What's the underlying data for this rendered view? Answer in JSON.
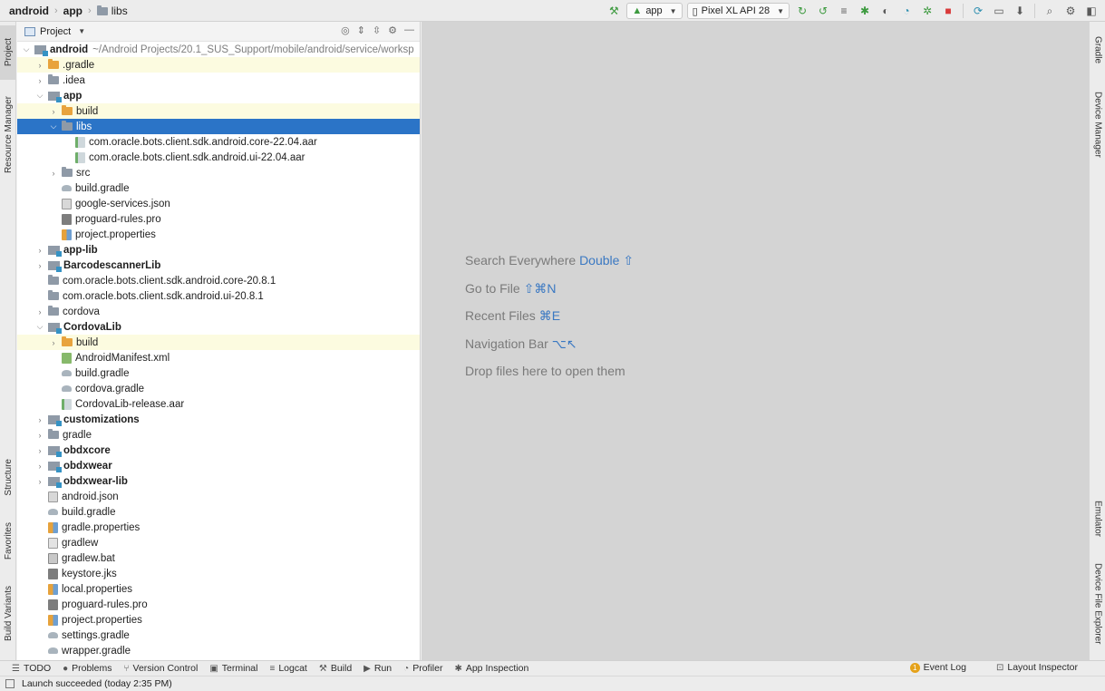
{
  "breadcrumb": [
    "android",
    "app",
    "libs"
  ],
  "toolbar": {
    "run_config": "app",
    "device": "Pixel XL API 28"
  },
  "left_tabs": [
    "Project",
    "Resource Manager",
    "Structure",
    "Favorites",
    "Build Variants"
  ],
  "right_tabs": [
    "Gradle",
    "Device Manager",
    "Emulator",
    "Device File Explorer"
  ],
  "panel": {
    "title": "Project"
  },
  "tree": [
    {
      "depth": 0,
      "exp": "open",
      "icon": "module",
      "name": "android",
      "bold": true,
      "path": "~/Android Projects/20.1_SUS_Support/mobile/android/service/worksp",
      "hl": false,
      "sel": false
    },
    {
      "depth": 1,
      "exp": "closed",
      "icon": "folder-orange",
      "name": ".gradle",
      "bold": false,
      "hl": true,
      "sel": false
    },
    {
      "depth": 1,
      "exp": "closed",
      "icon": "folder",
      "name": ".idea",
      "bold": false,
      "hl": false,
      "sel": false
    },
    {
      "depth": 1,
      "exp": "open",
      "icon": "module",
      "name": "app",
      "bold": true,
      "hl": false,
      "sel": false
    },
    {
      "depth": 2,
      "exp": "closed",
      "icon": "folder-orange",
      "name": "build",
      "bold": false,
      "hl": true,
      "sel": false
    },
    {
      "depth": 2,
      "exp": "open",
      "icon": "folder",
      "name": "libs",
      "bold": false,
      "hl": false,
      "sel": true
    },
    {
      "depth": 3,
      "exp": "none",
      "icon": "aar",
      "name": "com.oracle.bots.client.sdk.android.core-22.04.aar",
      "bold": false,
      "hl": false,
      "sel": false
    },
    {
      "depth": 3,
      "exp": "none",
      "icon": "aar",
      "name": "com.oracle.bots.client.sdk.android.ui-22.04.aar",
      "bold": false,
      "hl": false,
      "sel": false
    },
    {
      "depth": 2,
      "exp": "closed",
      "icon": "folder",
      "name": "src",
      "bold": false,
      "hl": false,
      "sel": false
    },
    {
      "depth": 2,
      "exp": "none",
      "icon": "gradle",
      "name": "build.gradle",
      "bold": false,
      "hl": false,
      "sel": false
    },
    {
      "depth": 2,
      "exp": "none",
      "icon": "json",
      "name": "google-services.json",
      "bold": false,
      "hl": false,
      "sel": false
    },
    {
      "depth": 2,
      "exp": "none",
      "icon": "pro",
      "name": "proguard-rules.pro",
      "bold": false,
      "hl": false,
      "sel": false
    },
    {
      "depth": 2,
      "exp": "none",
      "icon": "props",
      "name": "project.properties",
      "bold": false,
      "hl": false,
      "sel": false
    },
    {
      "depth": 1,
      "exp": "closed",
      "icon": "module",
      "name": "app-lib",
      "bold": true,
      "hl": false,
      "sel": false
    },
    {
      "depth": 1,
      "exp": "closed",
      "icon": "module",
      "name": "BarcodescannerLib",
      "bold": true,
      "hl": false,
      "sel": false
    },
    {
      "depth": 1,
      "exp": "none",
      "icon": "folder",
      "name": "com.oracle.bots.client.sdk.android.core-20.8.1",
      "bold": false,
      "hl": false,
      "sel": false
    },
    {
      "depth": 1,
      "exp": "none",
      "icon": "folder",
      "name": "com.oracle.bots.client.sdk.android.ui-20.8.1",
      "bold": false,
      "hl": false,
      "sel": false
    },
    {
      "depth": 1,
      "exp": "closed",
      "icon": "folder",
      "name": "cordova",
      "bold": false,
      "hl": false,
      "sel": false
    },
    {
      "depth": 1,
      "exp": "open",
      "icon": "module",
      "name": "CordovaLib",
      "bold": true,
      "hl": false,
      "sel": false
    },
    {
      "depth": 2,
      "exp": "closed",
      "icon": "folder-orange",
      "name": "build",
      "bold": false,
      "hl": true,
      "sel": false
    },
    {
      "depth": 2,
      "exp": "none",
      "icon": "xml",
      "name": "AndroidManifest.xml",
      "bold": false,
      "hl": false,
      "sel": false
    },
    {
      "depth": 2,
      "exp": "none",
      "icon": "gradle",
      "name": "build.gradle",
      "bold": false,
      "hl": false,
      "sel": false
    },
    {
      "depth": 2,
      "exp": "none",
      "icon": "gradle",
      "name": "cordova.gradle",
      "bold": false,
      "hl": false,
      "sel": false
    },
    {
      "depth": 2,
      "exp": "none",
      "icon": "aar",
      "name": "CordovaLib-release.aar",
      "bold": false,
      "hl": false,
      "sel": false
    },
    {
      "depth": 1,
      "exp": "closed",
      "icon": "module",
      "name": "customizations",
      "bold": true,
      "hl": false,
      "sel": false
    },
    {
      "depth": 1,
      "exp": "closed",
      "icon": "folder",
      "name": "gradle",
      "bold": false,
      "hl": false,
      "sel": false
    },
    {
      "depth": 1,
      "exp": "closed",
      "icon": "module",
      "name": "obdxcore",
      "bold": true,
      "hl": false,
      "sel": false
    },
    {
      "depth": 1,
      "exp": "closed",
      "icon": "module",
      "name": "obdxwear",
      "bold": true,
      "hl": false,
      "sel": false
    },
    {
      "depth": 1,
      "exp": "closed",
      "icon": "module",
      "name": "obdxwear-lib",
      "bold": true,
      "hl": false,
      "sel": false
    },
    {
      "depth": 1,
      "exp": "none",
      "icon": "json",
      "name": "android.json",
      "bold": false,
      "hl": false,
      "sel": false
    },
    {
      "depth": 1,
      "exp": "none",
      "icon": "gradle",
      "name": "build.gradle",
      "bold": false,
      "hl": false,
      "sel": false
    },
    {
      "depth": 1,
      "exp": "none",
      "icon": "props",
      "name": "gradle.properties",
      "bold": false,
      "hl": false,
      "sel": false
    },
    {
      "depth": 1,
      "exp": "none",
      "icon": "file",
      "name": "gradlew",
      "bold": false,
      "hl": false,
      "sel": false
    },
    {
      "depth": 1,
      "exp": "none",
      "icon": "bat",
      "name": "gradlew.bat",
      "bold": false,
      "hl": false,
      "sel": false
    },
    {
      "depth": 1,
      "exp": "none",
      "icon": "pro",
      "name": "keystore.jks",
      "bold": false,
      "hl": false,
      "sel": false
    },
    {
      "depth": 1,
      "exp": "none",
      "icon": "props",
      "name": "local.properties",
      "bold": false,
      "hl": false,
      "sel": false
    },
    {
      "depth": 1,
      "exp": "none",
      "icon": "pro",
      "name": "proguard-rules.pro",
      "bold": false,
      "hl": false,
      "sel": false
    },
    {
      "depth": 1,
      "exp": "none",
      "icon": "props",
      "name": "project.properties",
      "bold": false,
      "hl": false,
      "sel": false
    },
    {
      "depth": 1,
      "exp": "none",
      "icon": "gradle",
      "name": "settings.gradle",
      "bold": false,
      "hl": false,
      "sel": false
    },
    {
      "depth": 1,
      "exp": "none",
      "icon": "gradle",
      "name": "wrapper.gradle",
      "bold": false,
      "hl": false,
      "sel": false
    }
  ],
  "editor_hints": [
    {
      "text": "Search Everywhere",
      "key": "Double ⇧"
    },
    {
      "text": "Go to File",
      "key": "⇧⌘N"
    },
    {
      "text": "Recent Files",
      "key": "⌘E"
    },
    {
      "text": "Navigation Bar",
      "key": "⌥↖"
    },
    {
      "text": "Drop files here to open them",
      "key": ""
    }
  ],
  "bottom_tabs": [
    "TODO",
    "Problems",
    "Version Control",
    "Terminal",
    "Logcat",
    "Build",
    "Run",
    "Profiler",
    "App Inspection"
  ],
  "bottom_right": {
    "event_log": "Event Log",
    "event_badge": "1",
    "layout_inspector": "Layout Inspector"
  },
  "status": "Launch succeeded (today 2:35 PM)",
  "colors": {
    "selection": "#2b74c7",
    "folder_orange": "#e8a33d",
    "hint_key": "#3a78c2"
  }
}
